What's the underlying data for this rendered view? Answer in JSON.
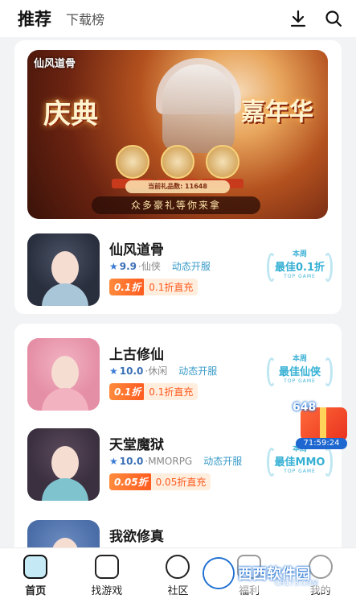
{
  "header": {
    "tab_recommend": "推荐",
    "tab_download": "下载榜",
    "download_icon": "download-icon",
    "search_icon": "search-icon"
  },
  "banner": {
    "logo": "仙风道骨",
    "title_left": "庆典",
    "title_right": "嘉年华",
    "counter": "当前礼品数: 11648",
    "slogan": "众多豪礼等你来拿"
  },
  "games": [
    {
      "name": "仙风道骨",
      "rating": "9.9",
      "genre": "仙侠",
      "tag": "动态开服",
      "discount_badge": "0.1折",
      "discount_text": "0.1折直充",
      "award_top": "本周",
      "award_main": "最佳0.1折",
      "award_sub": "TOP GAME",
      "hair_color": "#2a2f3e",
      "body_color": "#a9c6d8"
    },
    {
      "name": "上古修仙",
      "rating": "10.0",
      "genre": "休闲",
      "tag": "动态开服",
      "discount_badge": "0.1折",
      "discount_text": "0.1折直充",
      "award_top": "本周",
      "award_main": "最佳仙侠",
      "award_sub": "TOP GAME",
      "hair_color": "#e58fa6",
      "body_color": "#f3b2c0"
    },
    {
      "name": "天堂魔狱",
      "rating": "10.0",
      "genre": "MMORPG",
      "tag": "动态开服",
      "discount_badge": "0.05折",
      "discount_text": "0.05折直充",
      "award_top": "本周",
      "award_main": "最佳MMO",
      "award_sub": "TOP GAME",
      "hair_color": "#3b3040",
      "body_color": "#7fc3cf"
    },
    {
      "name": "我欲修真",
      "hair_color": "#4a6da8",
      "body_color": "#a7c6e8"
    }
  ],
  "float_gift": {
    "count": "648",
    "timer": "71:59:24"
  },
  "bottom_nav": [
    {
      "label": "首页",
      "icon": "home-icon"
    },
    {
      "label": "找游戏",
      "icon": "gamepad-icon"
    },
    {
      "label": "社区",
      "icon": "community-icon"
    },
    {
      "label": "福利",
      "icon": "gift-icon"
    },
    {
      "label": "我的",
      "icon": "profile-icon"
    }
  ],
  "watermark": {
    "text": "西西软件园",
    "sub": "CR173.COM"
  }
}
